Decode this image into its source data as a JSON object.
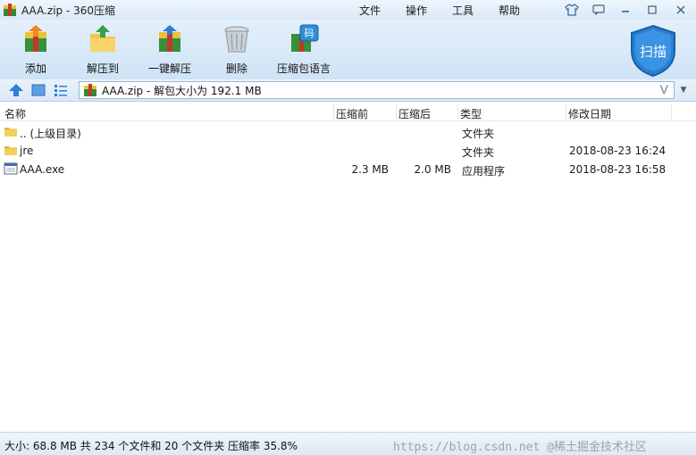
{
  "window": {
    "title": "AAA.zip - 360压缩"
  },
  "menu": {
    "items": [
      "文件",
      "操作",
      "工具",
      "帮助"
    ]
  },
  "toolbar": {
    "buttons": [
      {
        "label": "添加",
        "icon": "add-archive-icon"
      },
      {
        "label": "解压到",
        "icon": "extract-to-icon"
      },
      {
        "label": "一键解压",
        "icon": "one-click-extract-icon"
      },
      {
        "label": "删除",
        "icon": "trash-icon"
      },
      {
        "label": "压缩包语言",
        "icon": "archive-language-icon"
      }
    ],
    "scan_label": "扫描"
  },
  "addressbar": {
    "path": "AAA.zip - 解包大小为 192.1 MB",
    "v_glyph": "V"
  },
  "columns": {
    "name": "名称",
    "before": "压缩前",
    "after": "压缩后",
    "type": "类型",
    "modified": "修改日期"
  },
  "files": [
    {
      "name": ".. (上级目录)",
      "before": "",
      "after": "",
      "type": "文件夹",
      "modified": "",
      "icon": "folder-icon"
    },
    {
      "name": "jre",
      "before": "",
      "after": "",
      "type": "文件夹",
      "modified": "2018-08-23 16:24",
      "icon": "folder-icon"
    },
    {
      "name": "AAA.exe",
      "before": "2.3 MB",
      "after": "2.0 MB",
      "type": "应用程序",
      "modified": "2018-08-23 16:58",
      "icon": "exe-icon"
    }
  ],
  "status": {
    "text": "大小: 68.8 MB 共 234 个文件和 20 个文件夹 压缩率 35.8%"
  },
  "watermark": {
    "text": "https://blog.csdn.net @稀土掘金技术社区"
  },
  "colors": {
    "toolbar_bg": "#cfe3f6",
    "shield": "#2a7fd4",
    "folder": "#f3c34c"
  }
}
